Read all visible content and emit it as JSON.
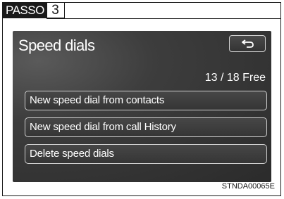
{
  "step": {
    "label": "PASSO",
    "number": "3"
  },
  "screen": {
    "title": "Speed dials",
    "back_icon": "return-arrow-icon",
    "free_count": "13 / 18 Free",
    "buttons": [
      {
        "label": "New speed dial from contacts"
      },
      {
        "label": "New speed dial from call History"
      },
      {
        "label": "Delete speed dials"
      }
    ]
  },
  "caption": "STNDA00065E",
  "colors": {
    "screen_bg": "#2b2b2b",
    "button_border": "#cfcfcf",
    "text": "#ffffff"
  }
}
